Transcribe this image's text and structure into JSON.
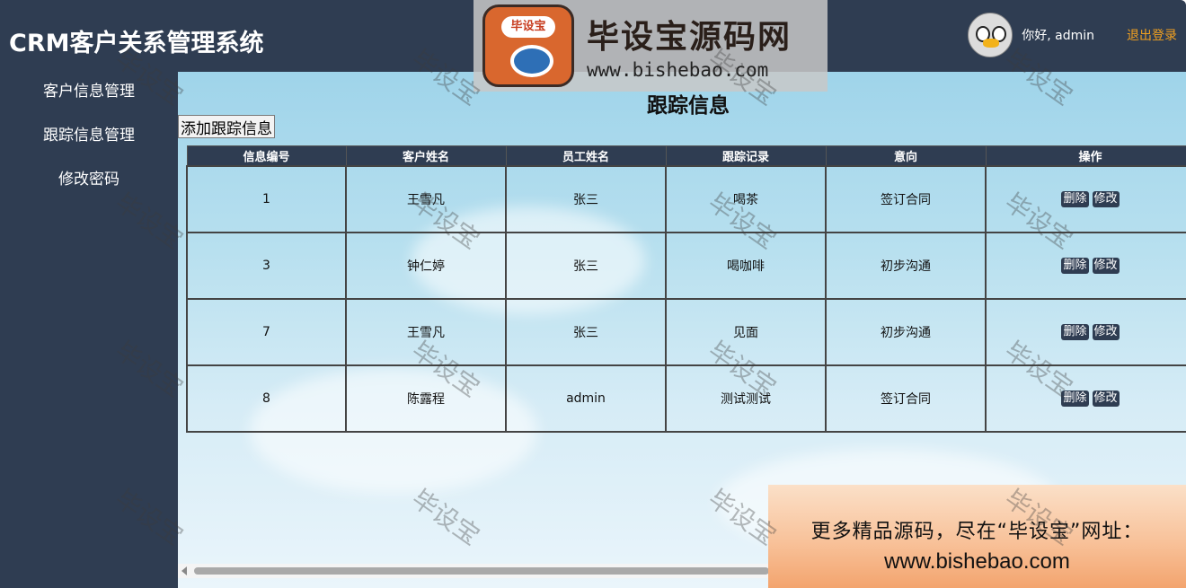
{
  "header": {
    "title": "CRM客户关系管理系统",
    "greeting": "你好, admin",
    "logout_label": "退出登录"
  },
  "sidebar": {
    "items": [
      {
        "label": "客户信息管理"
      },
      {
        "label": "跟踪信息管理"
      },
      {
        "label": "修改密码"
      }
    ]
  },
  "main": {
    "page_title": "跟踪信息",
    "add_button_label": "添加跟踪信息",
    "columns": [
      "信息编号",
      "客户姓名",
      "员工姓名",
      "跟踪记录",
      "意向",
      "操作"
    ],
    "rows": [
      {
        "id": "1",
        "customer": "王雪凡",
        "employee": "张三",
        "record": "喝茶",
        "intent": "签订合同"
      },
      {
        "id": "3",
        "customer": "钟仁婷",
        "employee": "张三",
        "record": "喝咖啡",
        "intent": "初步沟通"
      },
      {
        "id": "7",
        "customer": "王雪凡",
        "employee": "张三",
        "record": "见面",
        "intent": "初步沟通"
      },
      {
        "id": "8",
        "customer": "陈露程",
        "employee": "admin",
        "record": "测试测试",
        "intent": "签订合同"
      }
    ],
    "delete_label": "删除",
    "edit_label": "修改"
  },
  "brand": {
    "logo_text": "毕设宝",
    "name": "毕设宝源码网",
    "url": "www.bishebao.com"
  },
  "promo": {
    "line1": "更多精品源码，尽在“毕设宝”网址：",
    "line2": "www.bishebao.com"
  },
  "watermark": "毕设宝",
  "colors": {
    "nav_bg": "#2f3d52",
    "logout": "#f0a020",
    "table_header": "#2f3d52"
  }
}
